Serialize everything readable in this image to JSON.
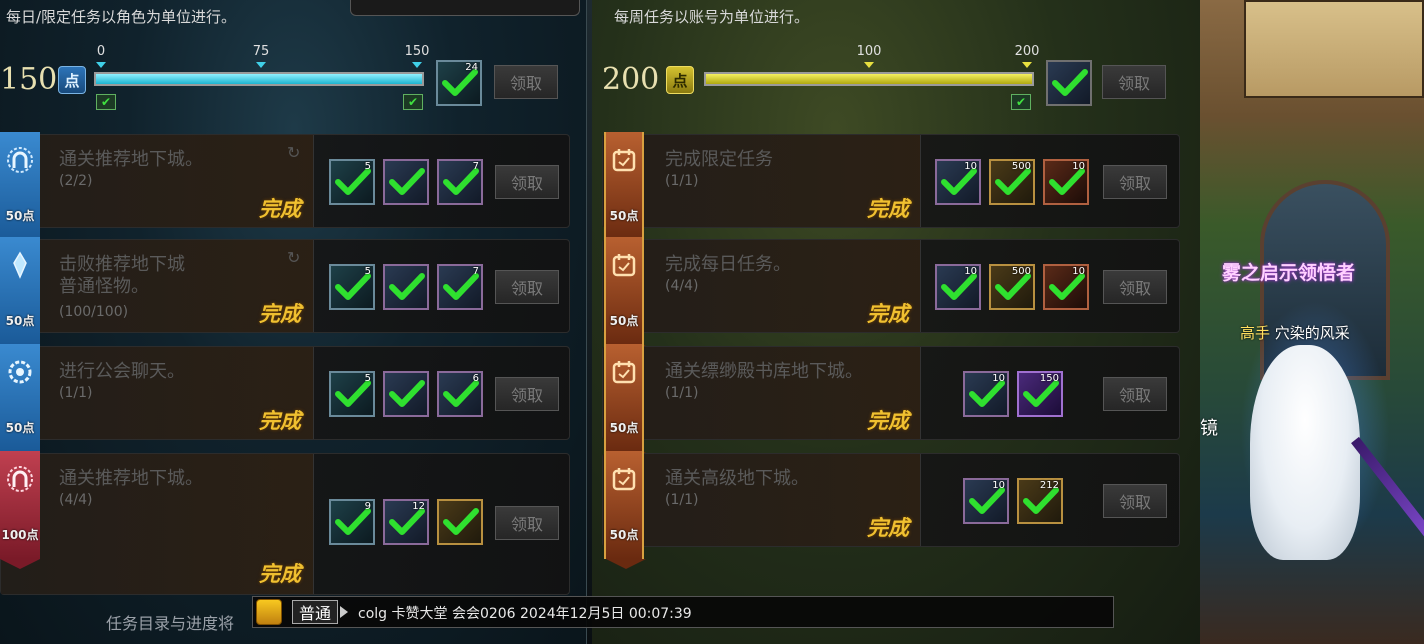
{
  "daily": {
    "header": "每日/限定任务以角色为单位进行。",
    "points": "150",
    "points_unit": "点",
    "progress": {
      "current": 150,
      "max": 150,
      "ticks": [
        "0",
        "75",
        "150"
      ]
    },
    "milestone_reward": {
      "count": "24"
    },
    "claim_label": "领取",
    "tasks": [
      {
        "title": "通关推荐地下城。",
        "progress": "(2/2)",
        "status": "完成",
        "points": "50点",
        "rewards": [
          "5",
          "",
          "7"
        ],
        "claim": "领取"
      },
      {
        "title": "击败推荐地下城\n普通怪物。",
        "progress": "(100/100)",
        "status": "完成",
        "points": "50点",
        "rewards": [
          "5",
          "",
          "7"
        ],
        "claim": "领取"
      },
      {
        "title": "进行公会聊天。",
        "progress": "(1/1)",
        "status": "完成",
        "points": "50点",
        "rewards": [
          "5",
          "",
          "6"
        ],
        "claim": "领取"
      },
      {
        "title": "通关推荐地下城。",
        "progress": "(4/4)",
        "status": "完成",
        "points": "100点",
        "rewards": [
          "9",
          "12",
          ""
        ],
        "claim": "领取"
      }
    ],
    "footer_tip": "任务目录与进度将"
  },
  "weekly": {
    "header": "每周任务以账号为单位进行。",
    "points": "200",
    "points_unit": "点",
    "progress": {
      "current": 200,
      "max": 200,
      "ticks": [
        "100",
        "200"
      ]
    },
    "milestone_reward": {
      "count": ""
    },
    "claim_label": "领取",
    "tasks": [
      {
        "title": "完成限定任务",
        "progress": "(1/1)",
        "status": "完成",
        "points": "50点",
        "rewards": [
          "10",
          "500",
          "10"
        ],
        "claim": "领取"
      },
      {
        "title": "完成每日任务。",
        "progress": "(4/4)",
        "status": "完成",
        "points": "50点",
        "rewards": [
          "10",
          "500",
          "10"
        ],
        "claim": "领取"
      },
      {
        "title": "通关缥缈殿书库地下城。",
        "progress": "(1/1)",
        "status": "完成",
        "points": "50点",
        "rewards": [
          "10",
          "150"
        ],
        "claim": "领取"
      },
      {
        "title": "通关高级地下城。",
        "progress": "(1/1)",
        "status": "完成",
        "points": "50点",
        "rewards": [
          "10",
          "212"
        ],
        "claim": "领取"
      }
    ]
  },
  "chat": {
    "channel": "普通",
    "message": "colg 卡赞大堂 会会0206 2024年12月5日 00:07:39"
  },
  "game": {
    "title_name": "雾之启示领悟者",
    "prefix": "高手",
    "player_name": "穴染的风采",
    "side_text": "镜"
  },
  "colors": {
    "cyan": "#1cb4d0",
    "yellow": "#e8e040",
    "complete": "#f0c030"
  }
}
